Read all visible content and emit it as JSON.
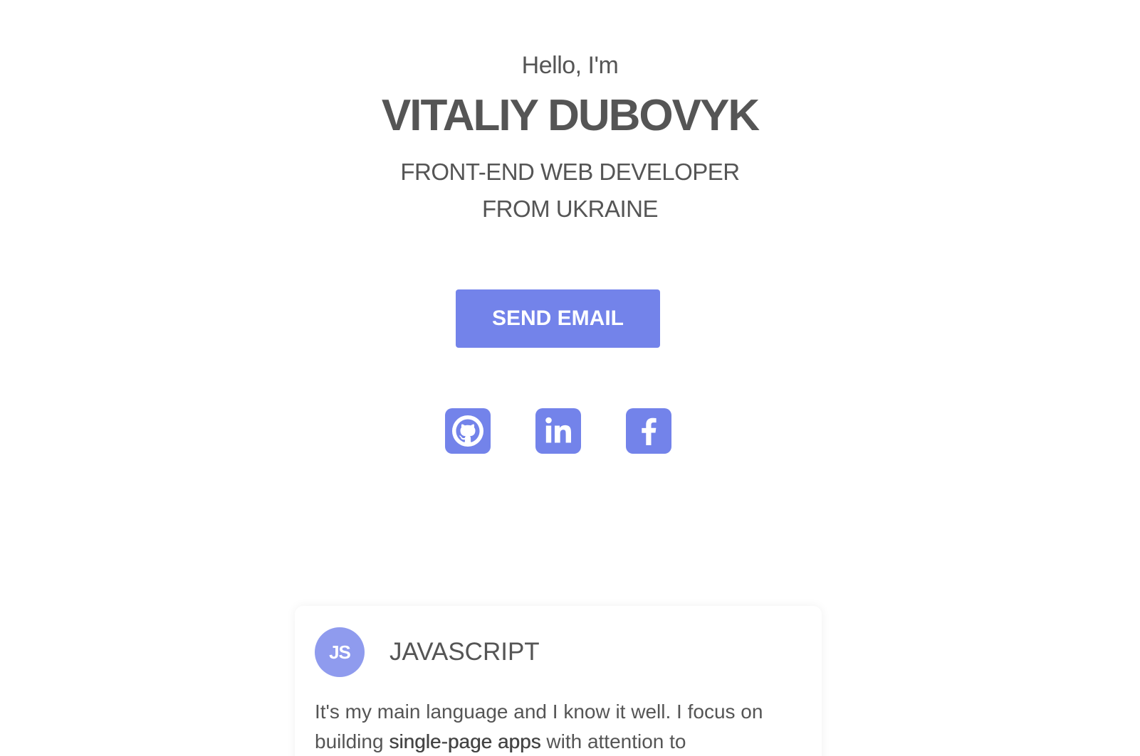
{
  "hero": {
    "greeting": "Hello, I'm",
    "name": "VITALIY DUBOVYK",
    "role_line1": "FRONT-END WEB DEVELOPER",
    "role_line2": "FROM UKRAINE",
    "send_email_label": "SEND EMAIL"
  },
  "socials": [
    {
      "icon": "github-icon"
    },
    {
      "icon": "linkedin-icon"
    },
    {
      "icon": "facebook-icon"
    }
  ],
  "skill_card": {
    "badge": "JS",
    "title": "JAVASCRIPT",
    "text_before": "It's my main language and I know it well. I focus on building ",
    "text_strong": "single-page apps",
    "text_after": " with attention to"
  },
  "colors": {
    "accent": "#7383ea",
    "badge": "#8f9bee",
    "text": "#555555",
    "background": "#ffffff"
  }
}
